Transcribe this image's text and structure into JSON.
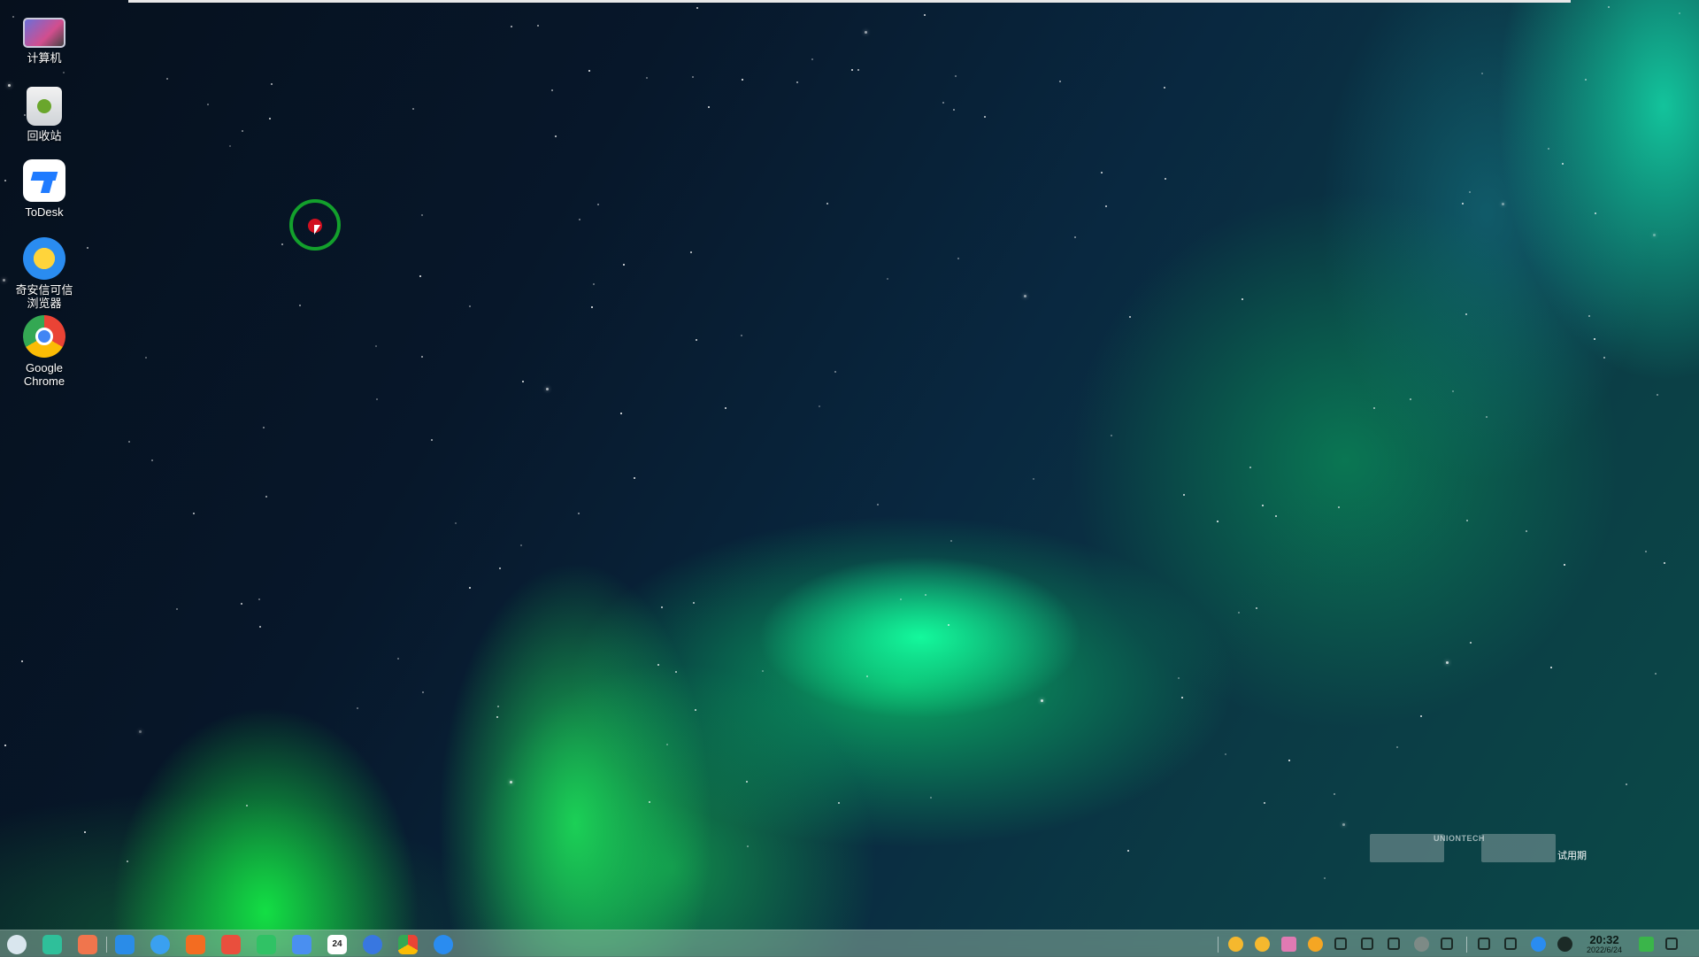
{
  "desktop": {
    "icons": [
      {
        "label": "计算机",
        "icon": "computer-icon"
      },
      {
        "label": "回收站",
        "icon": "trash-icon"
      },
      {
        "label": "ToDesk",
        "icon": "todesk-icon"
      },
      {
        "label": "奇安信可信\n浏览器",
        "icon": "qianxin-browser-icon"
      },
      {
        "label": "Google\nChrome",
        "icon": "chrome-icon"
      }
    ]
  },
  "watermark": {
    "brand": "UNIONTECH",
    "trial": "试用期"
  },
  "taskbar": {
    "apps": [
      {
        "name": "launcher",
        "icon": "launcher-icon",
        "color": "#d9e6ee"
      },
      {
        "name": "multitask-view",
        "icon": "multitask-icon",
        "color": "#2fbf9a"
      },
      {
        "name": "app-store",
        "icon": "appstore-icon",
        "color": "#f0754d"
      },
      {
        "name": "file-manager",
        "icon": "folder-icon",
        "color": "#2a8ce8"
      },
      {
        "name": "browser",
        "icon": "browser-icon",
        "color": "#3aa0f0"
      },
      {
        "name": "app-market",
        "icon": "market-icon",
        "color": "#f36c21"
      },
      {
        "name": "image-viewer",
        "icon": "image-icon",
        "color": "#e94f3d"
      },
      {
        "name": "music",
        "icon": "music-icon",
        "color": "#30c265"
      },
      {
        "name": "document-viewer",
        "icon": "document-icon",
        "color": "#4a8ff0"
      },
      {
        "name": "calendar",
        "icon": "calendar-icon",
        "color": "#ffffff",
        "text": "24"
      },
      {
        "name": "settings",
        "icon": "settings-icon",
        "color": "#3877e0"
      },
      {
        "name": "chrome",
        "icon": "chrome-icon",
        "color": "#ea4335"
      },
      {
        "name": "qianxin-browser",
        "icon": "qianxin-browser-icon",
        "color": "#2a8cf0"
      }
    ],
    "tray": [
      {
        "name": "qianxin-tray",
        "icon": "qianxin-tray-icon",
        "color": "#f5b82e"
      },
      {
        "name": "qianxin-tray-2",
        "icon": "qianxin-tray-icon",
        "color": "#f5b82e"
      },
      {
        "name": "chat-tray",
        "icon": "chat-icon",
        "color": "#e07ab3"
      },
      {
        "name": "notify-tray",
        "icon": "alert-icon",
        "color": "#f5a623"
      },
      {
        "name": "network-transfer",
        "icon": "transfer-icon",
        "color": "#1b2a26"
      },
      {
        "name": "volume",
        "icon": "volume-icon",
        "color": "#1b2a26"
      },
      {
        "name": "pen",
        "icon": "pen-icon",
        "color": "#1b2a26"
      },
      {
        "name": "status",
        "icon": "circle-icon",
        "color": "#7d8a86"
      },
      {
        "name": "expand",
        "icon": "chevron-right-icon",
        "color": "#1b2a26"
      },
      {
        "name": "search",
        "icon": "search-icon",
        "color": "#1b2a26"
      },
      {
        "name": "keyboard",
        "icon": "keyboard-icon",
        "color": "#1b2a26"
      },
      {
        "name": "cloud",
        "icon": "cloud-icon",
        "color": "#2a8cf0"
      },
      {
        "name": "power",
        "icon": "power-icon",
        "color": "#1b2a26"
      },
      {
        "name": "security",
        "icon": "shield-icon",
        "color": "#3ab54a"
      },
      {
        "name": "notifications",
        "icon": "bell-icon",
        "color": "#1b2a26"
      }
    ],
    "clock": {
      "time": "20:32",
      "date": "2022/6/24"
    }
  }
}
